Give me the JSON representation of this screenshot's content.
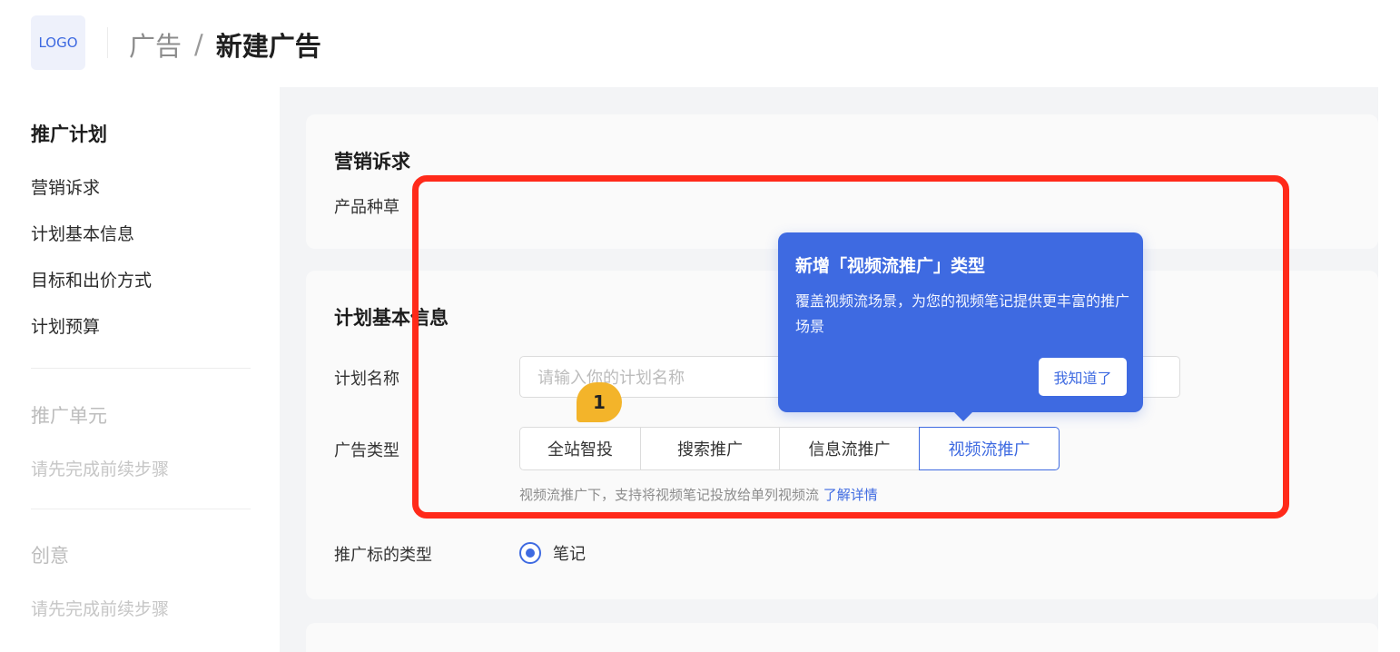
{
  "header": {
    "logo_text": "LOGO",
    "breadcrumb_parent": "广告",
    "breadcrumb_sep": "/",
    "breadcrumb_current": "新建广告"
  },
  "sidebar": {
    "section1_title": "推广计划",
    "items": [
      "营销诉求",
      "计划基本信息",
      "目标和出价方式",
      "计划预算"
    ],
    "section2_title": "推广单元",
    "section2_hint": "请先完成前续步骤",
    "section3_title": "创意",
    "section3_hint": "请先完成前续步骤"
  },
  "marketing": {
    "title": "营销诉求",
    "field_label": "产品种草"
  },
  "plan_info": {
    "title": "计划基本信息",
    "name_label": "计划名称",
    "name_placeholder": "请输入你的计划名称",
    "ad_type_label": "广告类型",
    "ad_types": [
      "全站智投",
      "搜索推广",
      "信息流推广",
      "视频流推广"
    ],
    "selected_ad_type": "视频流推广",
    "hint_text": "视频流推广下，支持将视频笔记投放给单列视频流",
    "hint_link": "了解详情",
    "target_type_label": "推广标的类型",
    "target_type_option": "笔记"
  },
  "tooltip": {
    "title": "新增「视频流推广」类型",
    "body": "覆盖视频流场景，为您的视频笔记提供更丰富的推广场景",
    "button": "我知道了"
  },
  "step_badge": "1",
  "colors": {
    "accent": "#3e6ae1",
    "highlight_border": "#ff2a1a",
    "badge": "#f3b42a",
    "main_bg": "#f3f4f6"
  }
}
